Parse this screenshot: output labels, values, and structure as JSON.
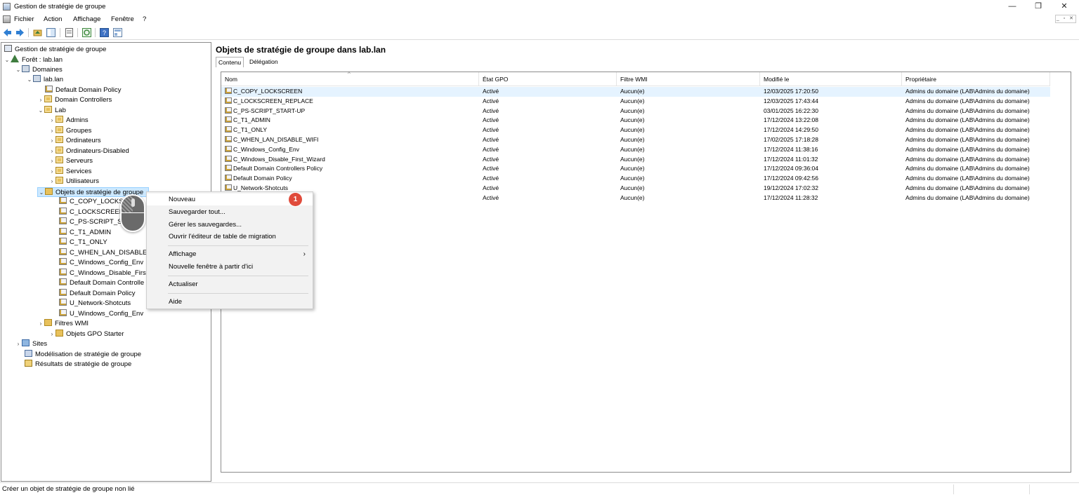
{
  "window": {
    "title": "Gestion de stratégie de groupe",
    "minimize": "—",
    "restore": "❐",
    "close": "✕"
  },
  "menubar": {
    "items": [
      "Fichier",
      "Action",
      "Affichage",
      "Fenêtre",
      "?"
    ],
    "mdi": "_ ▫ ✕"
  },
  "tree": {
    "root": "Gestion de stratégie de groupe",
    "forest": "Forêt : lab.lan",
    "domains": "Domaines",
    "domain": "lab.lan",
    "default_domain_policy": "Default Domain Policy",
    "domain_controllers": "Domain Controllers",
    "lab": "Lab",
    "ous": [
      "Admins",
      "Groupes",
      "Ordinateurs",
      "Ordinateurs-Disabled",
      "Serveurs",
      "Services",
      "Utilisateurs"
    ],
    "gpo_container": "Objets de stratégie de groupe",
    "gpos": [
      "C_COPY_LOCKSCR",
      "C_LOCKSCREEN_",
      "C_PS-SCRIPT_STA",
      "C_T1_ADMIN",
      "C_T1_ONLY",
      "C_WHEN_LAN_DISABLE_W",
      "C_Windows_Config_Env",
      "C_Windows_Disable_First_",
      "Default Domain Controlle",
      "Default Domain Policy",
      "U_Network-Shotcuts",
      "U_Windows_Config_Env"
    ],
    "wmi_filters": "Filtres WMI",
    "starter_gpos": "Objets GPO Starter",
    "sites": "Sites",
    "modeling": "Modélisation de stratégie de groupe",
    "results": "Résultats de stratégie de groupe"
  },
  "right": {
    "header": "Objets de stratégie de groupe dans lab.lan",
    "tabs": [
      "Contenu",
      "Délégation"
    ],
    "columns": [
      "Nom",
      "État GPO",
      "Filtre WMI",
      "Modifié le",
      "Propriétaire"
    ],
    "rows": [
      [
        "C_COPY_LOCKSCREEN",
        "Activé",
        "Aucun(e)",
        "12/03/2025 17:20:50",
        "Admins du domaine (LAB\\Admins du domaine)"
      ],
      [
        "C_LOCKSCREEN_REPLACE",
        "Activé",
        "Aucun(e)",
        "12/03/2025 17:43:44",
        "Admins du domaine (LAB\\Admins du domaine)"
      ],
      [
        "C_PS-SCRIPT_START-UP",
        "Activé",
        "Aucun(e)",
        "03/01/2025 16:22:30",
        "Admins du domaine (LAB\\Admins du domaine)"
      ],
      [
        "C_T1_ADMIN",
        "Activé",
        "Aucun(e)",
        "17/12/2024 13:22:08",
        "Admins du domaine (LAB\\Admins du domaine)"
      ],
      [
        "C_T1_ONLY",
        "Activé",
        "Aucun(e)",
        "17/12/2024 14:29:50",
        "Admins du domaine (LAB\\Admins du domaine)"
      ],
      [
        "C_WHEN_LAN_DISABLE_WIFI",
        "Activé",
        "Aucun(e)",
        "17/02/2025 17:18:28",
        "Admins du domaine (LAB\\Admins du domaine)"
      ],
      [
        "C_Windows_Config_Env",
        "Activé",
        "Aucun(e)",
        "17/12/2024 11:38:16",
        "Admins du domaine (LAB\\Admins du domaine)"
      ],
      [
        "C_Windows_Disable_First_Wizard",
        "Activé",
        "Aucun(e)",
        "17/12/2024 11:01:32",
        "Admins du domaine (LAB\\Admins du domaine)"
      ],
      [
        "Default Domain Controllers Policy",
        "Activé",
        "Aucun(e)",
        "17/12/2024 09:36:04",
        "Admins du domaine (LAB\\Admins du domaine)"
      ],
      [
        "Default Domain Policy",
        "Activé",
        "Aucun(e)",
        "17/12/2024 09:42:56",
        "Admins du domaine (LAB\\Admins du domaine)"
      ],
      [
        "U_Network-Shotcuts",
        "Activé",
        "Aucun(e)",
        "19/12/2024 17:02:32",
        "Admins du domaine (LAB\\Admins du domaine)"
      ],
      [
        "",
        "Activé",
        "Aucun(e)",
        "17/12/2024 11:28:32",
        "Admins du domaine (LAB\\Admins du domaine)"
      ]
    ]
  },
  "context_menu": {
    "items": [
      "Nouveau",
      "Sauvegarder tout...",
      "Gérer les sauvegardes...",
      "Ouvrir l'éditeur de table de migration",
      "Affichage",
      "Nouvelle fenêtre à partir d'ici",
      "Actualiser",
      "Aide"
    ],
    "submenu_arrow": "›"
  },
  "badge": "1",
  "status": {
    "text": "Créer un objet de stratégie de groupe non lié"
  }
}
